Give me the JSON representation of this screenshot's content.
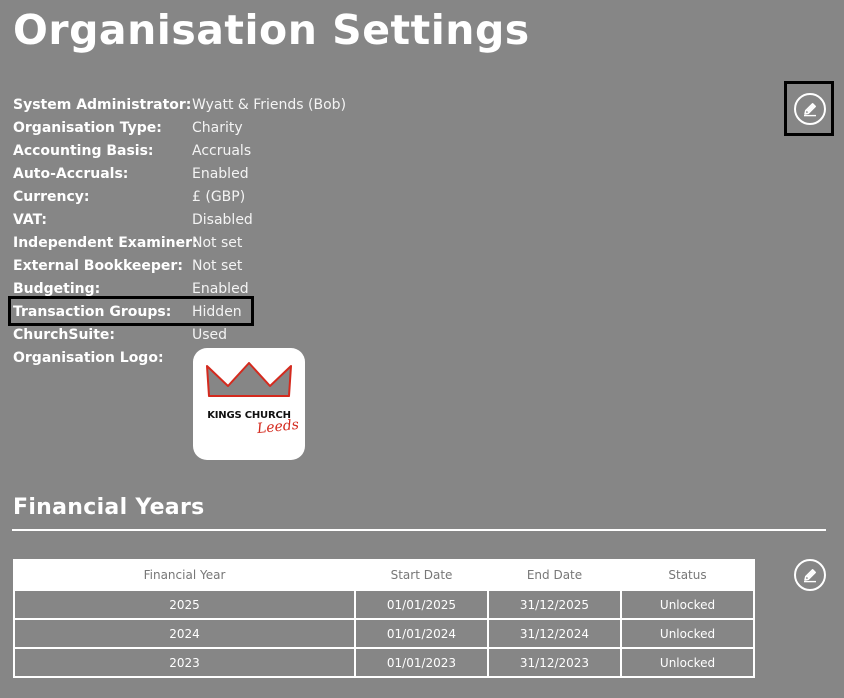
{
  "page": {
    "title": "Organisation Settings"
  },
  "toolbar": {
    "edit_icon": "pencil-icon"
  },
  "settings": [
    {
      "label": "System Administrator:",
      "value": "Wyatt & Friends (Bob)"
    },
    {
      "label": "Organisation Type:",
      "value": "Charity"
    },
    {
      "label": "Accounting Basis:",
      "value": "Accruals"
    },
    {
      "label": "Auto-Accruals:",
      "value": "Enabled"
    },
    {
      "label": "Currency:",
      "value": "£ (GBP)"
    },
    {
      "label": "VAT:",
      "value": "Disabled"
    },
    {
      "label": "Independent Examiner:",
      "value": "Not set"
    },
    {
      "label": "External Bookkeeper:",
      "value": "Not set"
    },
    {
      "label": "Budgeting:",
      "value": "Enabled"
    },
    {
      "label": "Transaction Groups:",
      "value": "Hidden"
    },
    {
      "label": "ChurchSuite:",
      "value": "Used"
    },
    {
      "label": "Organisation Logo:",
      "value": ""
    }
  ],
  "logo": {
    "name": "KINGS CHURCH",
    "script": "Leeds",
    "accent_color": "#d42a1e",
    "crown_color": "#868686"
  },
  "financial_years": {
    "title": "Financial Years",
    "headers": [
      "Financial Year",
      "Start Date",
      "End Date",
      "Status"
    ],
    "rows": [
      [
        "2025",
        "01/01/2025",
        "31/12/2025",
        "Unlocked"
      ],
      [
        "2024",
        "01/01/2024",
        "31/12/2024",
        "Unlocked"
      ],
      [
        "2023",
        "01/01/2023",
        "31/12/2023",
        "Unlocked"
      ]
    ]
  },
  "colors": {
    "background": "#868686",
    "text": "#ffffff",
    "highlight_border": "#000000"
  }
}
